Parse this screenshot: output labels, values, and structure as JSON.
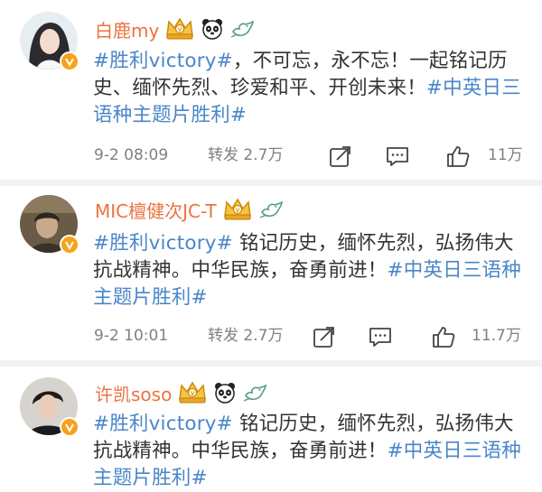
{
  "posts": [
    {
      "username": "白鹿my",
      "text_parts": [
        {
          "type": "tag",
          "text": "#胜利victory#"
        },
        {
          "type": "text",
          "text": "，不可忘，永不忘！一起铭记历史、缅怀先烈、珍爱和平、开创未来！"
        },
        {
          "type": "tag",
          "text": "#中英日三语种主题片胜利#"
        }
      ],
      "time": "9-2 08:09",
      "repost": "转发 2.7万",
      "likes": "11万"
    },
    {
      "username": "MIC檀健次JC-T",
      "text_parts": [
        {
          "type": "tag",
          "text": "#胜利victory#"
        },
        {
          "type": "text",
          "text": " 铭记历史，缅怀先烈，弘扬伟大抗战精神。中华民族，奋勇前进！"
        },
        {
          "type": "tag",
          "text": "#中英日三语种主题片胜利#"
        }
      ],
      "time": "9-2 10:01",
      "repost": "转发 2.7万",
      "likes": "11.7万"
    },
    {
      "username": "许凯soso",
      "text_parts": [
        {
          "type": "tag",
          "text": "#胜利victory#"
        },
        {
          "type": "text",
          "text": " 铭记历史，缅怀先烈，弘扬伟大抗战精神。中华民族，奋勇前进！"
        },
        {
          "type": "tag",
          "text": "#中英日三语种主题片胜利#"
        }
      ]
    }
  ],
  "icons": {
    "verified": "verified-badge-icon",
    "vip": "crown-vip-icon",
    "panda": "panda-icon",
    "bird": "bird-icon",
    "share": "share-icon",
    "comment": "comment-icon",
    "like": "thumbs-up-icon"
  },
  "colors": {
    "username": "#eb7340",
    "hashtag": "#4a86c8",
    "meta": "#808080",
    "verified": "#f7a21b",
    "divider": "#f2f2f2"
  }
}
